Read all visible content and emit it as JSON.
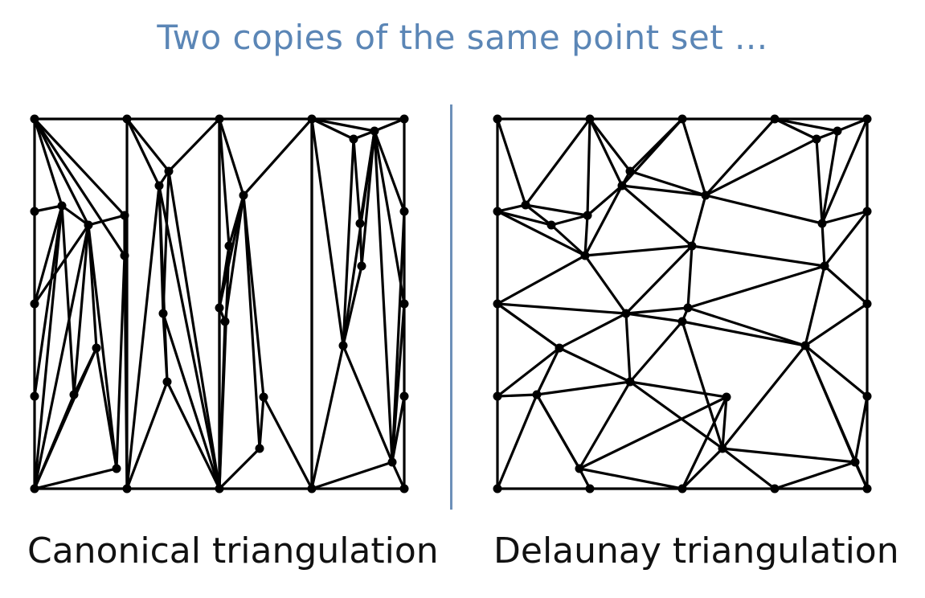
{
  "title": "Two copies of the same point set ...",
  "panels": [
    {
      "id": "left",
      "caption": "Canonical triangulation"
    },
    {
      "id": "right",
      "caption": "Delaunay triangulation"
    }
  ]
}
